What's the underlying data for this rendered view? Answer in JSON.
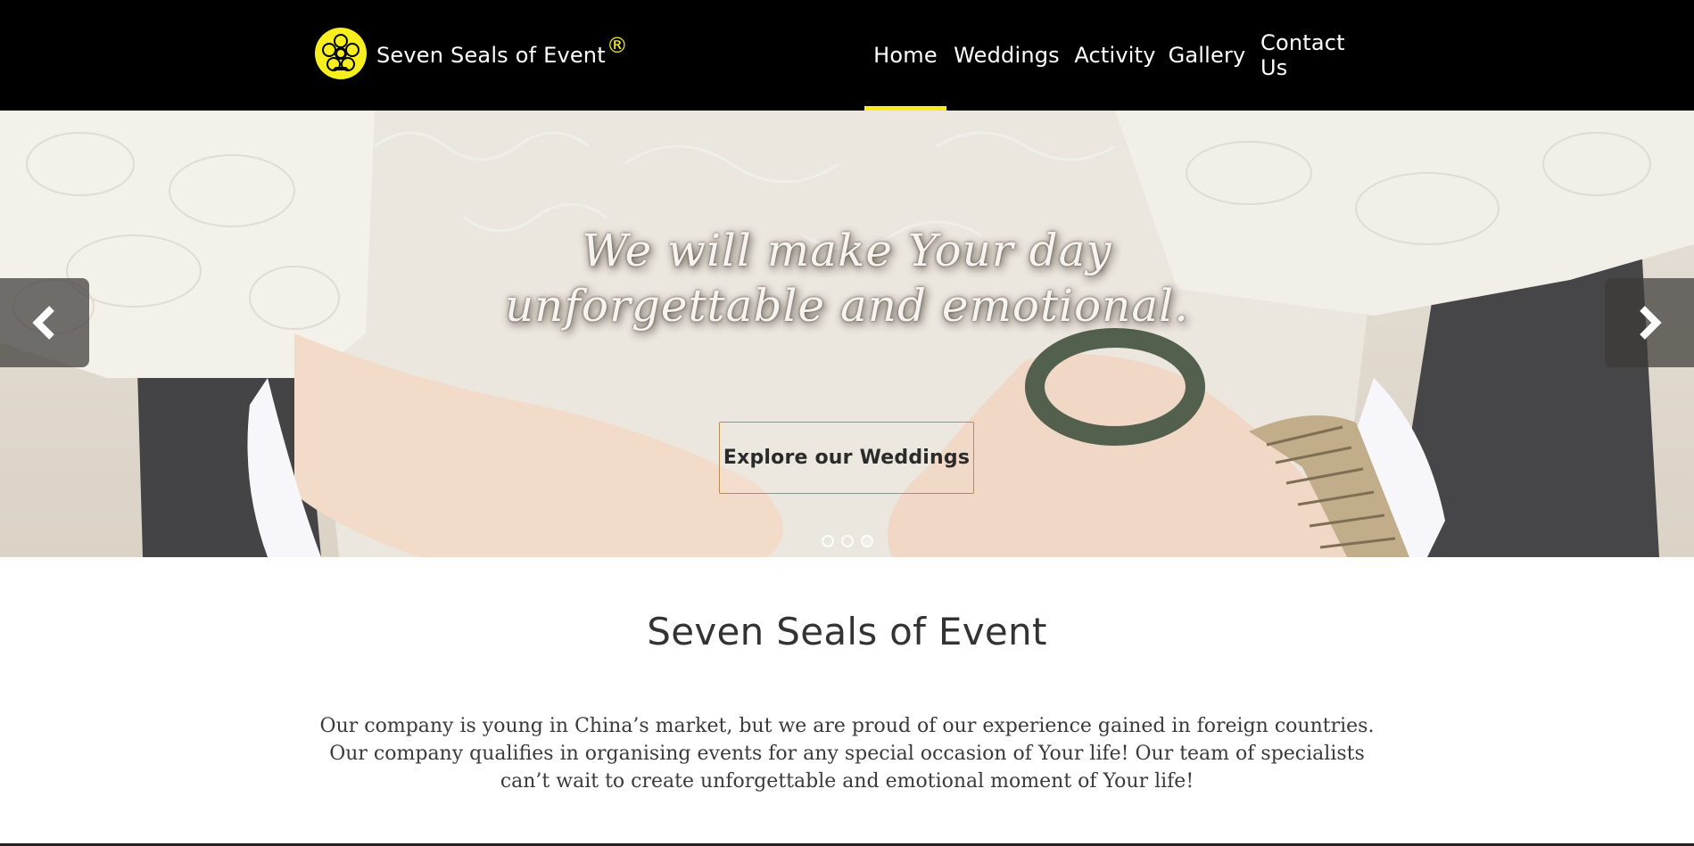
{
  "brand": {
    "name": "Seven Seals of Event",
    "registered_mark": "®",
    "logo_icon": "yellow-seal-flower-logo",
    "accent_color": "#f6ee1f"
  },
  "nav": {
    "items": [
      {
        "label": "Home",
        "active": true
      },
      {
        "label": "Weddings",
        "active": false
      },
      {
        "label": "Activity",
        "active": false
      },
      {
        "label": "Gallery",
        "active": false
      },
      {
        "label": "Contact Us",
        "active": false
      }
    ],
    "active_indicator_color": "#f6ee1f"
  },
  "hero": {
    "caption_line1": "We will make Your day",
    "caption_line2": "unforgettable and emotional.",
    "button_label": "Explore our Weddings",
    "prev_icon": "chevron-left-icon",
    "next_icon": "chevron-right-icon",
    "slide_count": 3,
    "active_slide": 3
  },
  "about": {
    "title": "Seven Seals of Event",
    "line1": "Our company is young in China’s market, but we are proud of our experience gained in foreign countries.",
    "line2": "Our company qualifies in organising events for any special occasion of Your life! Our team of specialists",
    "line3": "can’t wait to create unforgettable and emotional moment of Your life!"
  }
}
